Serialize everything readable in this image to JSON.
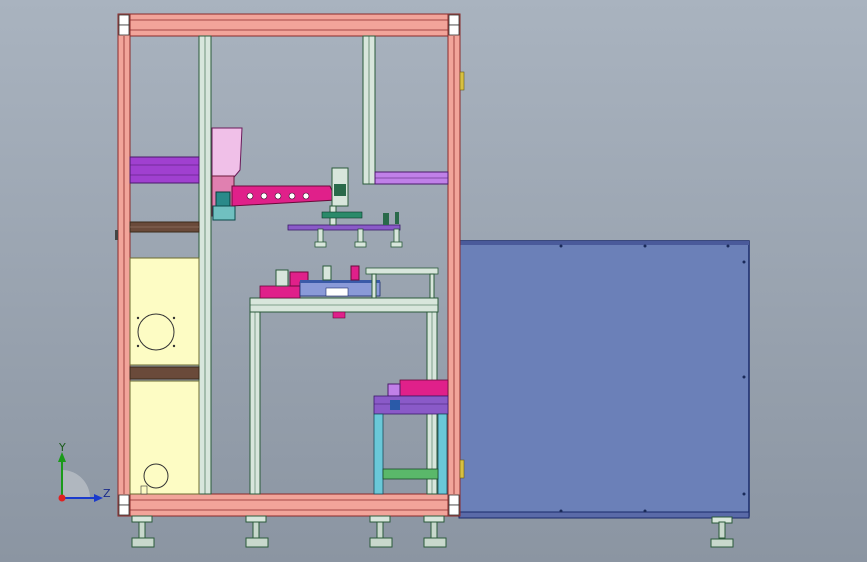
{
  "viewport": {
    "background_top": "#a9b3bf",
    "background_bottom": "#8b95a2"
  },
  "colors": {
    "frame_salmon": "#f2a49a",
    "frame_edge": "#8a2a2a",
    "aluminum": "#d8e6dc",
    "aluminum_edge": "#2a5a3a",
    "purple": "#a040d0",
    "magenta": "#e0208a",
    "panel_blue": "#6b80b8",
    "panel_edge": "#1a2a6a",
    "cream": "#fdfcc4",
    "dark_green": "#3a6a4a"
  },
  "triad": {
    "axis_y": "Y",
    "axis_z": "Z",
    "y_color": "#1a9a1a",
    "z_color": "#1a3acc",
    "origin_color": "#e02020"
  },
  "icons": {
    "triad": "coordinate-triad-icon"
  }
}
